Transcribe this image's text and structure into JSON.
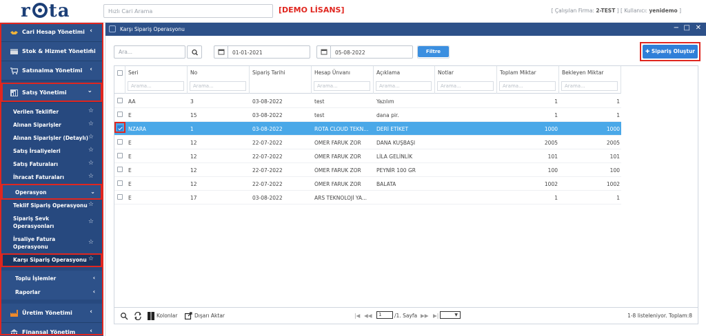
{
  "header": {
    "logo": "rota",
    "quick_search_placeholder": "Hızlı Cari Arama",
    "demo_label": "[DEMO LİSANS]",
    "user_info_prefix": "[ Çalışılan Firma: ",
    "company": "2-TEST",
    "user_info_middle": " ] [ Kullanıcı: ",
    "user": "yenidemo",
    "user_info_suffix": " ]"
  },
  "sidebar": {
    "sections": [
      {
        "label": "Cari Hesap Yönetimi",
        "icon": "handshake-icon"
      },
      {
        "label": "Stok & Hizmet Yönetimi",
        "icon": "box-icon"
      },
      {
        "label": "Satınalma Yönetimi",
        "icon": "cart-icon"
      },
      {
        "label": "Satış Yönetimi",
        "icon": "sales-icon"
      }
    ],
    "sales_items": [
      {
        "label": "Verilen Teklifler"
      },
      {
        "label": "Alınan Siparişler"
      },
      {
        "label": "Alınan Siparişler (Detaylı)"
      },
      {
        "label": "Satış İrsaliyeleri"
      },
      {
        "label": "Satış Faturaları"
      },
      {
        "label": "İhracat Faturaları"
      }
    ],
    "operations_group": "Operasyon",
    "operation_items": [
      {
        "label": "Teklif Sipariş Operasyonu"
      },
      {
        "label": "Sipariş Sevk Operasyonları"
      },
      {
        "label": "İrsaliye Fatura Operasyonu"
      },
      {
        "label": "Karşı Sipariş Operasyonu"
      }
    ],
    "groups": [
      {
        "label": "Toplu İşlemler"
      },
      {
        "label": "Raporlar"
      }
    ],
    "bottom_sections": [
      {
        "label": "Üretim Yönetimi"
      },
      {
        "label": "Finansal Yönetim"
      }
    ]
  },
  "window": {
    "title": "Karşı Sipariş Operasyonu",
    "controls": {
      "minimize": "−",
      "maximize": "□",
      "close": "✕"
    }
  },
  "filters": {
    "search_placeholder": "Ara...",
    "date_from": "01-01-2021",
    "date_to": "05-08-2022",
    "filter_button": "Filtre"
  },
  "create_button": "Sipariş Oluştur",
  "grid": {
    "filter_placeholder": "Arama...",
    "columns": [
      "Seri",
      "No",
      "Sipariş Tarihi",
      "Hesap Ünvanı",
      "Açıklama",
      "Notlar",
      "Toplam Miktar",
      "Bekleyen Miktar"
    ],
    "rows": [
      {
        "seri": "AA",
        "no": "3",
        "tarih": "03-08-2022",
        "unvan": "test",
        "aciklama": "Yazılım",
        "notlar": "",
        "toplam": "1",
        "bekleyen": "1",
        "checked": false
      },
      {
        "seri": "E",
        "no": "15",
        "tarih": "03-08-2022",
        "unvan": "test",
        "aciklama": "dana pir.",
        "notlar": "",
        "toplam": "1",
        "bekleyen": "1",
        "checked": false
      },
      {
        "seri": "NZARA",
        "no": "1",
        "tarih": "03-08-2022",
        "unvan": "ROTA CLOUD TEKN...",
        "aciklama": "DERİ ETİKET",
        "notlar": "",
        "toplam": "1000",
        "bekleyen": "1000",
        "checked": true
      },
      {
        "seri": "E",
        "no": "12",
        "tarih": "22-07-2022",
        "unvan": "ÖMER FARUK ZOR",
        "aciklama": "DANA KUŞBAŞI",
        "notlar": "",
        "toplam": "2005",
        "bekleyen": "2005",
        "checked": false
      },
      {
        "seri": "E",
        "no": "12",
        "tarih": "22-07-2022",
        "unvan": "ÖMER FARUK ZOR",
        "aciklama": "LİLA GELİNLİK",
        "notlar": "",
        "toplam": "101",
        "bekleyen": "101",
        "checked": false
      },
      {
        "seri": "E",
        "no": "12",
        "tarih": "22-07-2022",
        "unvan": "ÖMER FARUK ZOR",
        "aciklama": "PEYNİR 100 GR",
        "notlar": "",
        "toplam": "100",
        "bekleyen": "100",
        "checked": false
      },
      {
        "seri": "E",
        "no": "12",
        "tarih": "22-07-2022",
        "unvan": "ÖMER FARUK ZOR",
        "aciklama": "BALATA",
        "notlar": "",
        "toplam": "1002",
        "bekleyen": "1002",
        "checked": false
      },
      {
        "seri": "E",
        "no": "17",
        "tarih": "03-08-2022",
        "unvan": "ARS TEKNOLOJİ YA...",
        "aciklama": "",
        "notlar": "",
        "toplam": "1",
        "bekleyen": "1",
        "checked": false
      }
    ]
  },
  "footer": {
    "columns_label": "Kolonlar",
    "export_label": "Dışarı Aktar",
    "page_input": "1",
    "page_suffix": "/1. Sayfa",
    "summary": "1-8 listeleniyor. Toplam:8"
  },
  "colors": {
    "sidebar": "#27497f",
    "accent": "#2f7fd8",
    "selected_row": "#4aa8e8",
    "highlight_box": "#e0261f"
  }
}
